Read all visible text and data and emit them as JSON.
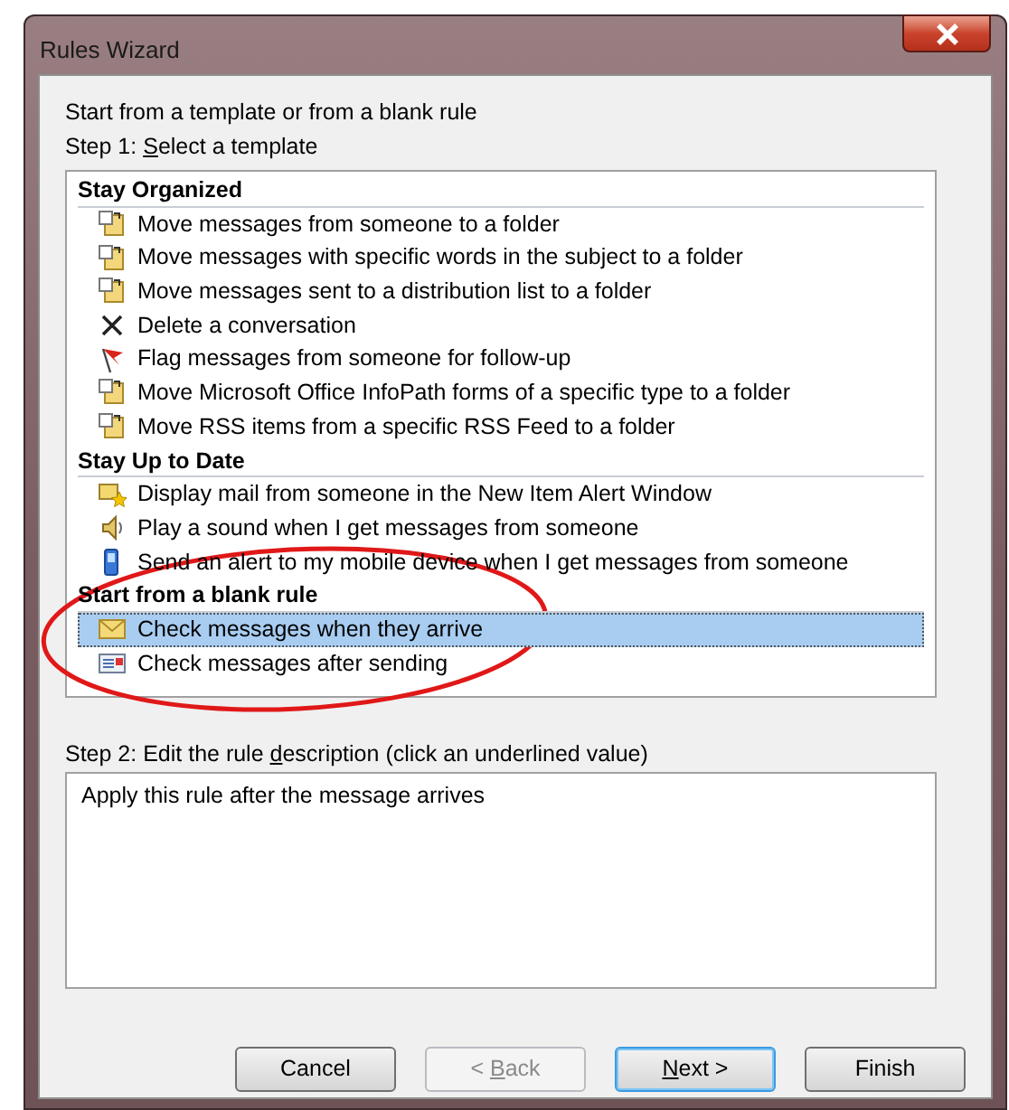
{
  "window": {
    "title": "Rules Wizard"
  },
  "intro": "Start from a template or from a blank rule",
  "step1": {
    "before": "Step 1: ",
    "key": "S",
    "after": "elect a template"
  },
  "groups": [
    {
      "title": "Stay Organized",
      "items": [
        {
          "label": "Move messages from someone to a folder",
          "kind": "move",
          "selected": false
        },
        {
          "label": "Move messages with specific words in the subject to a folder",
          "kind": "move",
          "selected": false
        },
        {
          "label": "Move messages sent to a distribution list to a folder",
          "kind": "move",
          "selected": false
        },
        {
          "label": "Delete a conversation",
          "kind": "delete",
          "selected": false
        },
        {
          "label": "Flag messages from someone for follow-up",
          "kind": "flag",
          "selected": false
        },
        {
          "label": "Move Microsoft Office InfoPath forms of a specific type to a folder",
          "kind": "move",
          "selected": false
        },
        {
          "label": "Move RSS items from a specific RSS Feed to a folder",
          "kind": "move",
          "selected": false
        }
      ]
    },
    {
      "title": "Stay Up to Date",
      "items": [
        {
          "label": "Display mail from someone in the New Item Alert Window",
          "kind": "alert",
          "selected": false
        },
        {
          "label": "Play a sound when I get messages from someone",
          "kind": "sound",
          "selected": false
        },
        {
          "label": "Send an alert to my mobile device when I get messages from someone",
          "kind": "mobile",
          "selected": false
        }
      ]
    },
    {
      "title": "Start from a blank rule",
      "items": [
        {
          "label": "Check messages when they arrive",
          "kind": "mail",
          "selected": true
        },
        {
          "label": "Check messages after sending",
          "kind": "send",
          "selected": false
        }
      ]
    }
  ],
  "step2": {
    "before": "Step 2: Edit the rule ",
    "key": "d",
    "after": "escription (click an underlined value)"
  },
  "description": "Apply this rule after the message arrives",
  "buttons": [
    {
      "after": "Cancel",
      "disabled": false,
      "default": false
    },
    {
      "before": "< ",
      "key": "B",
      "after": "ack",
      "disabled": true,
      "default": false
    },
    {
      "key": "N",
      "after": "ext >",
      "disabled": false,
      "default": true
    },
    {
      "after": "Finish",
      "disabled": false,
      "default": false
    }
  ]
}
